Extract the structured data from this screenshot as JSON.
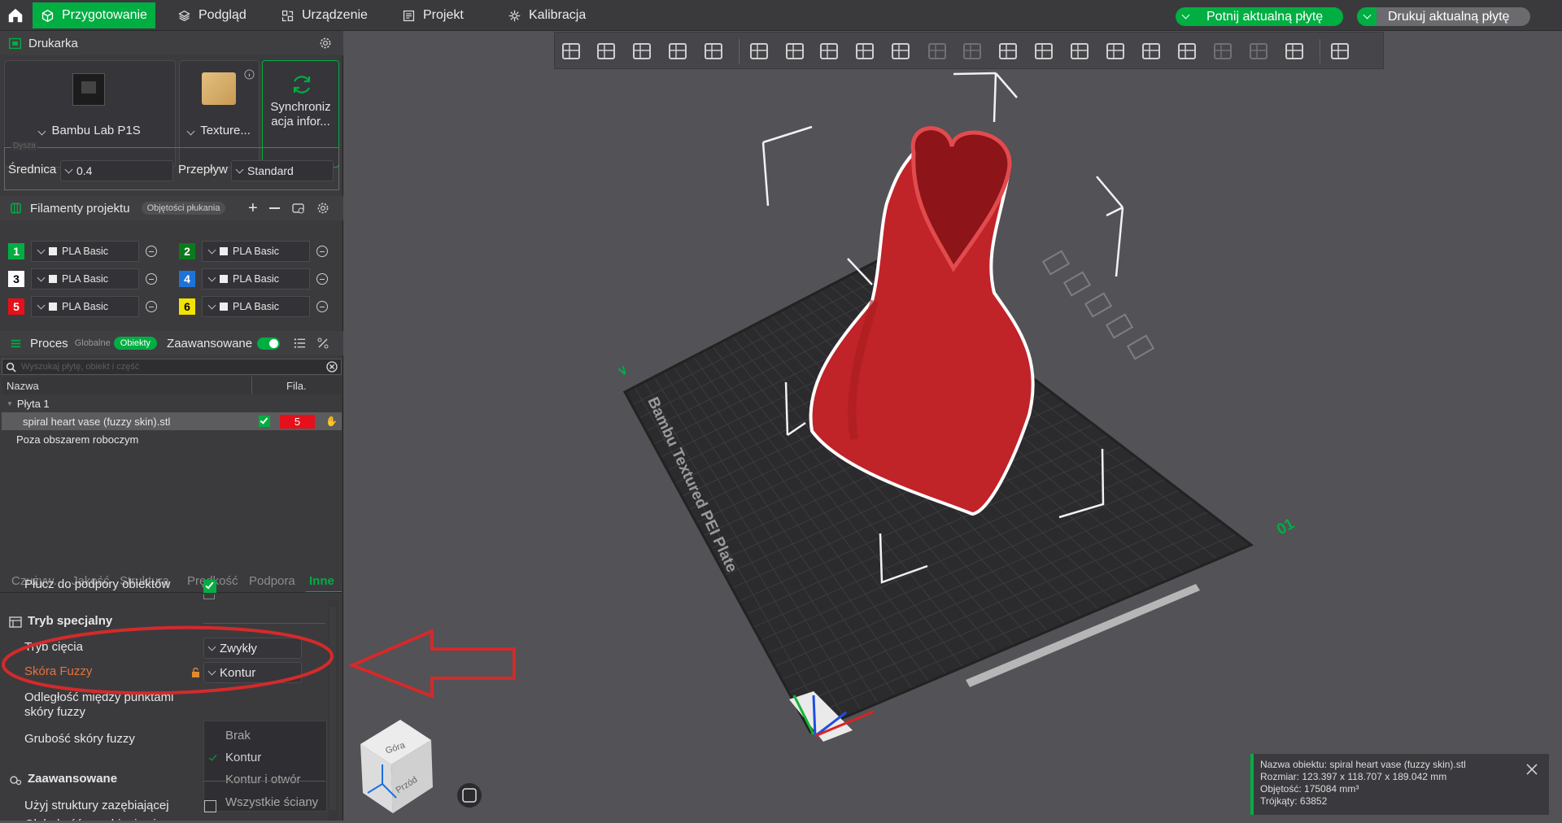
{
  "topbar": {
    "tabs": [
      "Przygotowanie",
      "Podgląd",
      "Urządzenie",
      "Projekt",
      "Kalibracja"
    ],
    "slice_btn": "Potnij aktualną płytę",
    "print_btn": "Drukuj aktualną płytę"
  },
  "printer": {
    "title": "Drukarka",
    "model": "Bambu Lab P1S",
    "plate": "Texture...",
    "sync": "Synchronizacja infor...",
    "sync_l1": "Synchroniz",
    "sync_l2": "acja infor...",
    "nozzle_group": "Dysza",
    "diameter_label": "Średnica",
    "diameter_value": "0.4",
    "flow_label": "Przepływ",
    "flow_value": "Standard"
  },
  "filaments": {
    "title": "Filamenty projektu",
    "badge": "Objętości płukania",
    "items": [
      {
        "n": "1",
        "name": "PLA Basic",
        "color": "#00ae42",
        "tc": "#fff"
      },
      {
        "n": "2",
        "name": "PLA Basic",
        "color": "#0a7a1c",
        "tc": "#fff"
      },
      {
        "n": "3",
        "name": "PLA Basic",
        "color": "#ffffff",
        "tc": "#000"
      },
      {
        "n": "4",
        "name": "PLA Basic",
        "color": "#1e73d8",
        "tc": "#fff"
      },
      {
        "n": "5",
        "name": "PLA Basic",
        "color": "#e5101a",
        "tc": "#fff"
      },
      {
        "n": "6",
        "name": "PLA Basic",
        "color": "#f2e300",
        "tc": "#000"
      }
    ]
  },
  "process": {
    "title": "Proces",
    "global": "Globalne",
    "objects": "Obiekty",
    "advanced": "Zaawansowane",
    "search_placeholder": "Wyszukaj płytę, obiekt i część",
    "col_name": "Nazwa",
    "col_fila": "Fila.",
    "plate": "Płyta 1",
    "object": "spiral heart vase (fuzzy skin).stl",
    "object_fila": "5",
    "outside": "Poza obszarem roboczym"
  },
  "settings_tabs": [
    "Czużyw.",
    "Jakość",
    "Struktura",
    "Prędkość",
    "Podpora",
    "Inne"
  ],
  "settings": {
    "flush_support": "Płucz do podpory obiektów",
    "special_mode": "Tryb specjalny",
    "slice_mode_label": "Tryb cięcia",
    "slice_mode_value": "Zwykły",
    "fuzzy_label": "Skóra Fuzzy",
    "fuzzy_value": "Kontur",
    "fuzzy_dist": "Odległość między punktami skóry fuzzy",
    "fuzzy_dist_l1": "Odległość między punktami",
    "fuzzy_dist_l2": "skóry fuzzy",
    "fuzzy_thick": "Grubość skóry fuzzy",
    "advanced": "Zaawansowane",
    "interlock": "Użyj struktury zazębiającej",
    "interlock_depth": "Głębokość zazębiania się"
  },
  "fuzzy_options": [
    "Brak",
    "Kontur",
    "Kontur i otwór",
    "Wszystkie ściany"
  ],
  "info": {
    "name": "Nazwa obiektu: spiral heart vase (fuzzy skin).stl",
    "size": "Rozmiar: 123.397 x 118.707 x 189.042 mm",
    "volume": "Objętość: 175084 mm³",
    "triangles": "Trójkąty: 63852"
  },
  "plate_label": "Bambu Textured PEI Plate",
  "plate_number": "01",
  "view_cube": {
    "top": "Góra",
    "front": "Przód"
  },
  "colors": {
    "accent": "#00ae42",
    "annotation": "#d42a2a",
    "model": "#c22326"
  }
}
